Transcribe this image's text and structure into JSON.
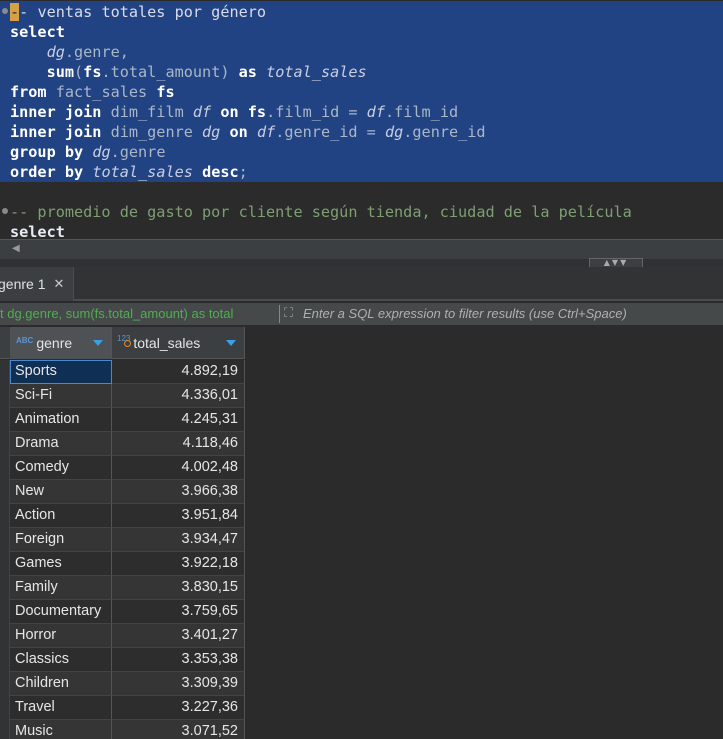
{
  "editor": {
    "selected_lines": [
      {
        "parts": [
          {
            "t": "-",
            "c": "caret"
          },
          {
            "t": "- ventas totales por género",
            "c": "cm"
          }
        ]
      },
      {
        "parts": [
          {
            "t": "select",
            "c": "kw"
          }
        ]
      },
      {
        "parts": [
          {
            "t": "    "
          },
          {
            "t": "dg",
            "c": "alias"
          },
          {
            "t": ".genre,"
          }
        ]
      },
      {
        "parts": [
          {
            "t": "    "
          },
          {
            "t": "sum",
            "c": "kw"
          },
          {
            "t": "("
          },
          {
            "t": "fs",
            "c": "kw"
          },
          {
            "t": ".total_amount) "
          },
          {
            "t": "as",
            "c": "kw"
          },
          {
            "t": " "
          },
          {
            "t": "total_sales",
            "c": "alias"
          }
        ]
      },
      {
        "parts": [
          {
            "t": "from",
            "c": "kw"
          },
          {
            "t": " fact_sales "
          },
          {
            "t": "fs",
            "c": "kw"
          }
        ]
      },
      {
        "parts": [
          {
            "t": "inner join",
            "c": "kw"
          },
          {
            "t": " dim_film "
          },
          {
            "t": "df",
            "c": "alias"
          },
          {
            "t": " "
          },
          {
            "t": "on",
            "c": "kw"
          },
          {
            "t": " "
          },
          {
            "t": "fs",
            "c": "kw"
          },
          {
            "t": ".film_id = "
          },
          {
            "t": "df",
            "c": "alias"
          },
          {
            "t": ".film_id"
          }
        ]
      },
      {
        "parts": [
          {
            "t": "inner join",
            "c": "kw"
          },
          {
            "t": " dim_genre "
          },
          {
            "t": "dg",
            "c": "alias"
          },
          {
            "t": " "
          },
          {
            "t": "on",
            "c": "kw"
          },
          {
            "t": " "
          },
          {
            "t": "df",
            "c": "alias"
          },
          {
            "t": ".genre_id = "
          },
          {
            "t": "dg",
            "c": "alias"
          },
          {
            "t": ".genre_id"
          }
        ]
      },
      {
        "parts": [
          {
            "t": "group by",
            "c": "kw"
          },
          {
            "t": " "
          },
          {
            "t": "dg",
            "c": "alias"
          },
          {
            "t": ".genre"
          }
        ]
      },
      {
        "parts": [
          {
            "t": "order by",
            "c": "kw"
          },
          {
            "t": " "
          },
          {
            "t": "total_sales",
            "c": "alias"
          },
          {
            "t": " "
          },
          {
            "t": "desc",
            "c": "kw"
          },
          {
            "t": ";"
          }
        ]
      }
    ],
    "other_lines": [
      {
        "parts": [
          {
            "t": "-- promedio de gasto por cliente según tienda, ciudad de la película",
            "c": "cm"
          }
        ]
      },
      {
        "parts": [
          {
            "t": "select",
            "c": "kw"
          }
        ]
      }
    ]
  },
  "results": {
    "tab_label": "genre 1",
    "tab_close": "✕",
    "filter_query": "t dg.genre, sum(fs.total_amount) as total",
    "filter_placeholder": "Enter a SQL expression to filter results (use Ctrl+Space)",
    "columns": [
      {
        "name": "genre",
        "type_badge": "ABC"
      },
      {
        "name": "total_sales",
        "type_badge": "123"
      }
    ],
    "rows": [
      [
        "Sports",
        "4.892,19"
      ],
      [
        "Sci-Fi",
        "4.336,01"
      ],
      [
        "Animation",
        "4.245,31"
      ],
      [
        "Drama",
        "4.118,46"
      ],
      [
        "Comedy",
        "4.002,48"
      ],
      [
        "New",
        "3.966,38"
      ],
      [
        "Action",
        "3.951,84"
      ],
      [
        "Foreign",
        "3.934,47"
      ],
      [
        "Games",
        "3.922,18"
      ],
      [
        "Family",
        "3.830,15"
      ],
      [
        "Documentary",
        "3.759,65"
      ],
      [
        "Horror",
        "3.401,27"
      ],
      [
        "Classics",
        "3.353,38"
      ],
      [
        "Children",
        "3.309,39"
      ],
      [
        "Travel",
        "3.227,36"
      ],
      [
        "Music",
        "3.071,52"
      ]
    ]
  },
  "icons": {
    "fold": "fold-marker-icon",
    "scroll_left": "scroll-left-arrow-icon",
    "filter": "expand-filter-icon",
    "sort": "sort-down-icon",
    "close": "close-icon"
  }
}
